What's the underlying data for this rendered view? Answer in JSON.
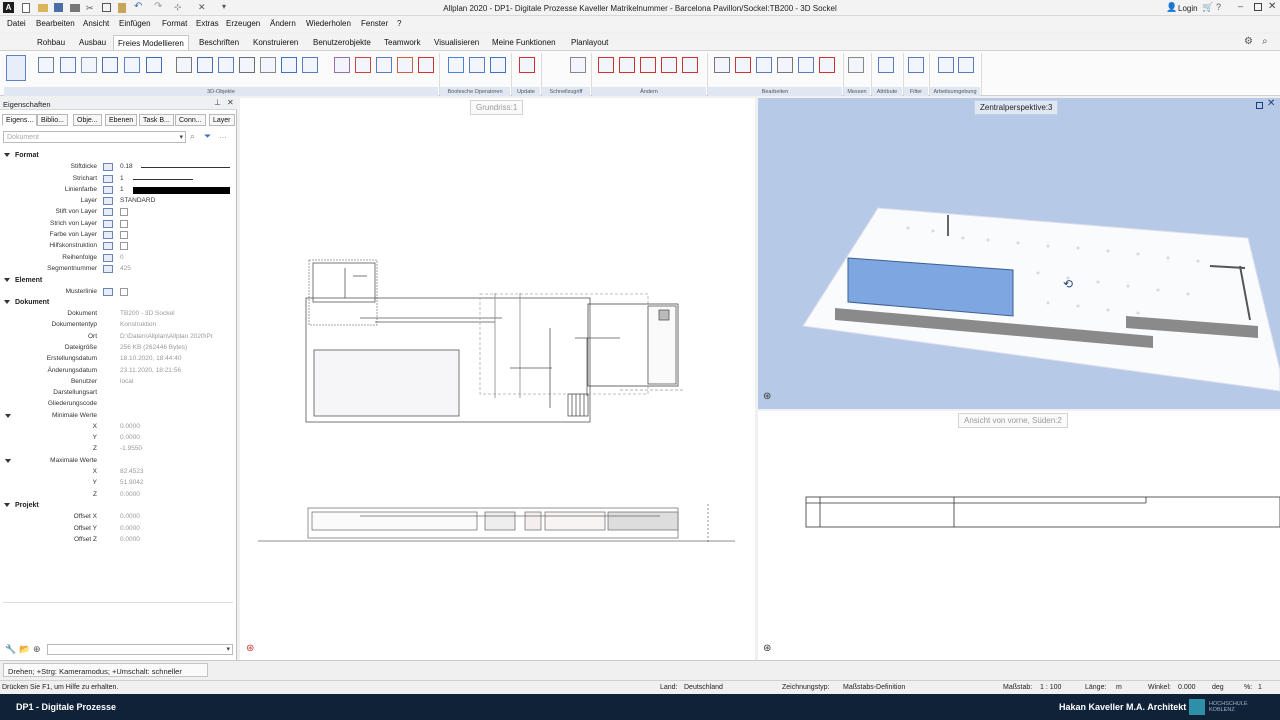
{
  "titlebar": {
    "title": "Allplan 2020 - DP1- Digitale Prozesse Kaveller Matrikelnummer - Barcelona Pavillon/Sockel:TB200 - 3D Sockel",
    "login": "Login"
  },
  "menu": [
    "Datei",
    "Bearbeiten",
    "Ansicht",
    "Einfügen",
    "Format",
    "Extras",
    "Erzeugen",
    "Ändern",
    "Wiederholen",
    "Fenster",
    "?"
  ],
  "ribbon_tabs": [
    "Rohbau",
    "Ausbau",
    "Freies Modellieren",
    "Beschriften",
    "Konstruieren",
    "Benutzerobjekte",
    "Teamwork",
    "Visualisieren",
    "Meine Funktionen",
    "Planlayout"
  ],
  "ribbon_active": "Freies Modellieren",
  "ribbon_groups": [
    "3D-Objekte",
    "Boolesche Operatoren",
    "Update",
    "Schnellzugriff",
    "Ändern",
    "Bearbeiten",
    "Messen",
    "Attribute",
    "Filter",
    "Arbeitsumgebung"
  ],
  "panel": {
    "title": "Eigenschaften",
    "tabs": [
      "Eigens...",
      "Biblio...",
      "Obje...",
      "Ebenen",
      "Task B...",
      "Conn...",
      "Layer"
    ],
    "dropdown_placeholder": "Dokument",
    "sections": {
      "format": "Format",
      "element": "Element",
      "dokument": "Dokument",
      "projekt": "Projekt"
    },
    "format_props": {
      "stiftdicke_label": "Stiftdicke",
      "stiftdicke_value": "0.18",
      "strichart_label": "Strichart",
      "strichart_value": "1",
      "linienfarbe_label": "Linienfarbe",
      "linienfarbe_value": "1",
      "layer_label": "Layer",
      "layer_value": "STANDARD",
      "stift_layer_label": "Stift von Layer",
      "strich_layer_label": "Strich von Layer",
      "farbe_layer_label": "Farbe von Layer",
      "hilfs_label": "Hilfskonstruktion",
      "reihenfolge_label": "Reihenfolge",
      "reihenfolge_value": "0",
      "segment_label": "Segmentnummer",
      "segment_value": "425"
    },
    "element_props": {
      "musterlinie_label": "Musterlinie"
    },
    "dokument_props": {
      "dokument_label": "Dokument",
      "dokument_value": "TB200 - 3D Sockel",
      "typ_label": "Dokumententyp",
      "typ_value": "Konstruktion",
      "ort_label": "Ort",
      "ort_value": "D:\\Daten\\Allplan\\Allplan 2020\\Pr",
      "groesse_label": "Dateigröße",
      "groesse_value": "256 KB (262446 Bytes)",
      "erstellung_label": "Erstellungsdatum",
      "erstellung_value": "18.10.2020, 18:44:40",
      "aenderung_label": "Änderungsdatum",
      "aenderung_value": "23.11.2020, 18:21:56",
      "benutzer_label": "Benutzer",
      "benutzer_value": "local",
      "darstellung_label": "Darstellungsart",
      "gliederung_label": "Gliederungscode",
      "min_label": "Minimale Werte",
      "min_x": "0.0000",
      "min_y": "0.0000",
      "min_z": "-1.9550",
      "max_label": "Maximale Werte",
      "max_x": "82.4523",
      "max_y": "51.9042",
      "max_z": "0.0000",
      "x": "X",
      "y": "Y",
      "z": "Z"
    },
    "projekt_props": {
      "ox_label": "Offset X",
      "ox_value": "0.0000",
      "oy_label": "Offset Y",
      "oy_value": "0.0000",
      "oz_label": "Offset Z",
      "oz_value": "0.0000"
    }
  },
  "viewports": {
    "grundriss": "Grundriss:1",
    "zentral": "Zentralperspektive:3",
    "ansicht": "Ansicht von vorne, Süden:2"
  },
  "cmdline": "Drehen; +Strg: Kameramodus; +Umschalt: schneller",
  "status": {
    "hint": "Drücken Sie F1, um Hilfe zu erhalten.",
    "land_label": "Land:",
    "land_value": "Deutschland",
    "zt_label": "Zeichnungstyp:",
    "zt_value": "Maßstabs-Definition",
    "massstab_label": "Maßstab:",
    "massstab_value": "1 : 100",
    "laenge_label": "Länge:",
    "laenge_value": "m",
    "winkel_label": "Winkel:",
    "winkel_value": "0.000",
    "winkel_unit": "deg",
    "pct_label": "%:",
    "pct_value": "1"
  },
  "bottom": {
    "left": "DP1 - Digitale Prozesse",
    "right": "Hakan Kaveller M.A. Architekt",
    "logo_text": "HOCHSCHULE KOBLENZ"
  },
  "colors": {
    "accent": "#2a66c2",
    "bottom_bar": "#0f2238",
    "perspective_bg": "#b6c9e6",
    "pool": "#7ea6e0"
  }
}
